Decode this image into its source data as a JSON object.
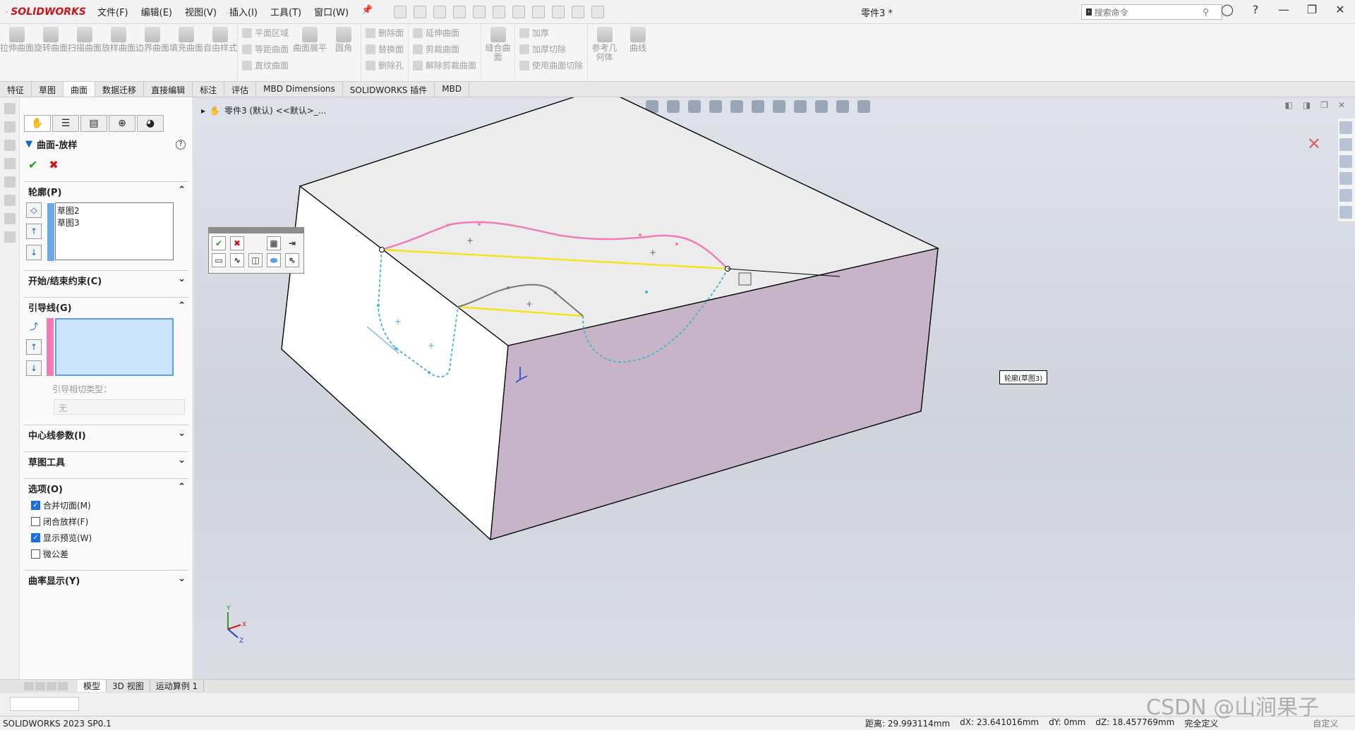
{
  "app": {
    "name": "SOLIDWORKS",
    "doc_title": "零件3 *",
    "version": "SOLIDWORKS 2023 SP0.1"
  },
  "menu": [
    "文件(F)",
    "编辑(E)",
    "视图(V)",
    "插入(I)",
    "工具(T)",
    "窗口(W)"
  ],
  "search": {
    "placeholder": "搜索命令"
  },
  "ribbon": {
    "big": [
      "拉伸曲面",
      "旋转曲面",
      "扫描曲面",
      "放样曲面",
      "边界曲面",
      "填充曲面",
      "自由样式"
    ],
    "col1": [
      "平面区域",
      "等距曲面",
      "直纹曲面"
    ],
    "big2": [
      "曲面展平",
      "圆角"
    ],
    "col2": [
      "删除面",
      "替换面",
      "删除孔"
    ],
    "col3": [
      "延伸曲面",
      "剪裁曲面",
      "解除剪裁曲面"
    ],
    "big3": [
      "缝合曲面"
    ],
    "col4": [
      "加厚",
      "加厚切除",
      "使用曲面切除"
    ],
    "big4": [
      "参考几何体",
      "曲线"
    ]
  },
  "tabs": [
    "特征",
    "草图",
    "曲面",
    "数据迁移",
    "直接编辑",
    "标注",
    "评估",
    "MBD Dimensions",
    "SOLIDWORKS 插件",
    "MBD"
  ],
  "active_tab": "曲面",
  "panel": {
    "title": "曲面-放样",
    "profiles": {
      "header": "轮廓(P)",
      "items": [
        "草图2",
        "草图3"
      ]
    },
    "start_end": {
      "header": "开始/结束约束(C)"
    },
    "guides": {
      "header": "引导线(G)",
      "tangency_label": "引导相切类型：",
      "tangency_value": "无"
    },
    "centerline": {
      "header": "中心线参数(I)"
    },
    "sketch_tools": {
      "header": "草图工具"
    },
    "options": {
      "header": "选项(O)",
      "items": [
        {
          "label": "合并切面(M)",
          "checked": true
        },
        {
          "label": "闭合放样(F)",
          "checked": false
        },
        {
          "label": "显示预览(W)",
          "checked": true
        },
        {
          "label": "微公差",
          "checked": false
        }
      ]
    },
    "curvature": {
      "header": "曲率显示(Y)"
    }
  },
  "viewport": {
    "breadcrumb": "零件3 (默认) <<默认>_...",
    "callout": "轮廓(草图3)"
  },
  "bottom_tabs": [
    "模型",
    "3D 视图",
    "运动算例 1"
  ],
  "status": {
    "distance": "距离: 29.993114mm",
    "dx": "dX: 23.641016mm",
    "dy": "dY: 0mm",
    "dz": "dZ: 18.457769mm",
    "state": "完全定义",
    "units": "自定义"
  },
  "watermark": "CSDN @山涧果子"
}
